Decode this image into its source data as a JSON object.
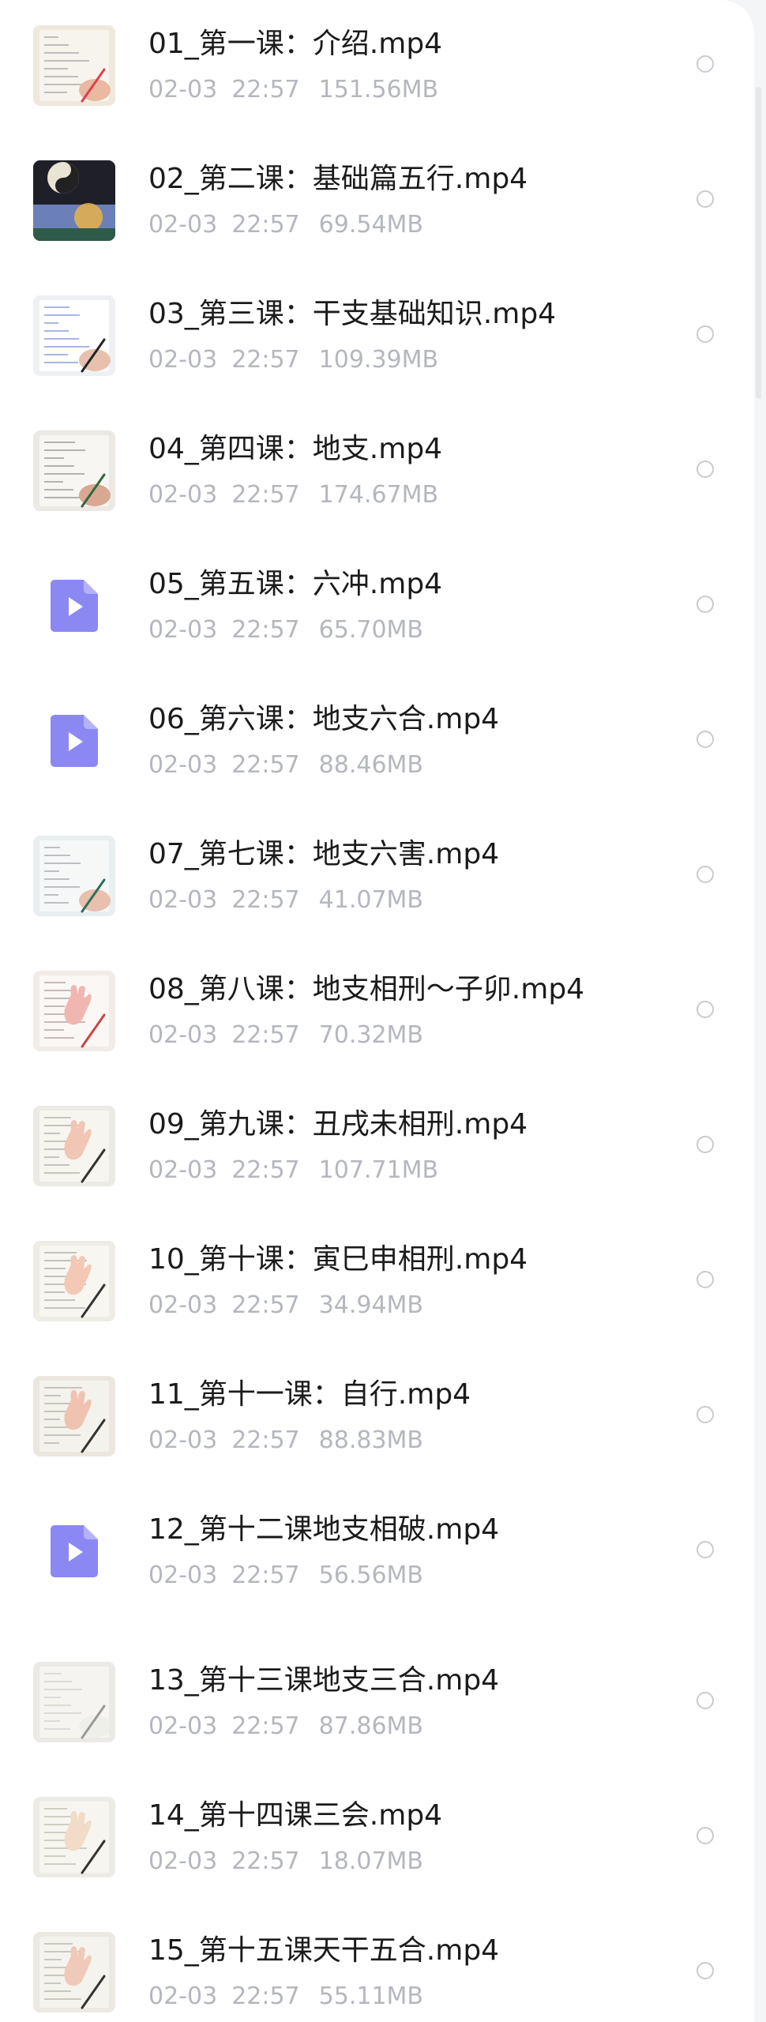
{
  "files": [
    {
      "name": "01_第一课：介绍.mp4",
      "date": "02-03",
      "time": "22:57",
      "size": "151.56MB",
      "thumb": "thumb",
      "icon": "video-thumbnail-icon"
    },
    {
      "name": "02_第二课：基础篇五行.mp4",
      "date": "02-03",
      "time": "22:57",
      "size": "69.54MB",
      "thumb": "thumb",
      "icon": "video-thumbnail-icon"
    },
    {
      "name": "03_第三课：干支基础知识.mp4",
      "date": "02-03",
      "time": "22:57",
      "size": "109.39MB",
      "thumb": "thumb",
      "icon": "video-thumbnail-icon"
    },
    {
      "name": "04_第四课：地支.mp4",
      "date": "02-03",
      "time": "22:57",
      "size": "174.67MB",
      "thumb": "thumb",
      "icon": "video-thumbnail-icon"
    },
    {
      "name": "05_第五课：六冲.mp4",
      "date": "02-03",
      "time": "22:57",
      "size": "65.70MB",
      "thumb": "play",
      "icon": "video-file-icon"
    },
    {
      "name": "06_第六课：地支六合.mp4",
      "date": "02-03",
      "time": "22:57",
      "size": "88.46MB",
      "thumb": "play",
      "icon": "video-file-icon"
    },
    {
      "name": "07_第七课：地支六害.mp4",
      "date": "02-03",
      "time": "22:57",
      "size": "41.07MB",
      "thumb": "thumb",
      "icon": "video-thumbnail-icon"
    },
    {
      "name": "08_第八课：地支相刑～子卯.mp4",
      "date": "02-03",
      "time": "22:57",
      "size": "70.32MB",
      "thumb": "thumb",
      "icon": "video-thumbnail-icon"
    },
    {
      "name": "09_第九课：丑戌未相刑.mp4",
      "date": "02-03",
      "time": "22:57",
      "size": "107.71MB",
      "thumb": "thumb",
      "icon": "video-thumbnail-icon"
    },
    {
      "name": "10_第十课：寅巳申相刑.mp4",
      "date": "02-03",
      "time": "22:57",
      "size": "34.94MB",
      "thumb": "thumb",
      "icon": "video-thumbnail-icon"
    },
    {
      "name": "11_第十一课：自行.mp4",
      "date": "02-03",
      "time": "22:57",
      "size": "88.83MB",
      "thumb": "thumb",
      "icon": "video-thumbnail-icon"
    },
    {
      "name": "12_第十二课地支相破.mp4",
      "date": "02-03",
      "time": "22:57",
      "size": "56.56MB",
      "thumb": "play",
      "icon": "video-file-icon"
    },
    {
      "name": "13_第十三课地支三合.mp4",
      "date": "02-03",
      "time": "22:57",
      "size": "87.86MB",
      "thumb": "thumb",
      "icon": "video-thumbnail-icon"
    },
    {
      "name": "14_第十四课三会.mp4",
      "date": "02-03",
      "time": "22:57",
      "size": "18.07MB",
      "thumb": "thumb",
      "icon": "video-thumbnail-icon"
    },
    {
      "name": "15_第十五课天干五合.mp4",
      "date": "02-03",
      "time": "22:57",
      "size": "55.11MB",
      "thumb": "thumb",
      "icon": "video-thumbnail-icon"
    }
  ],
  "colors": {
    "play_icon": "#8b88f4",
    "meta_text": "#b4b7bd",
    "name_text": "#1b1b1d"
  }
}
